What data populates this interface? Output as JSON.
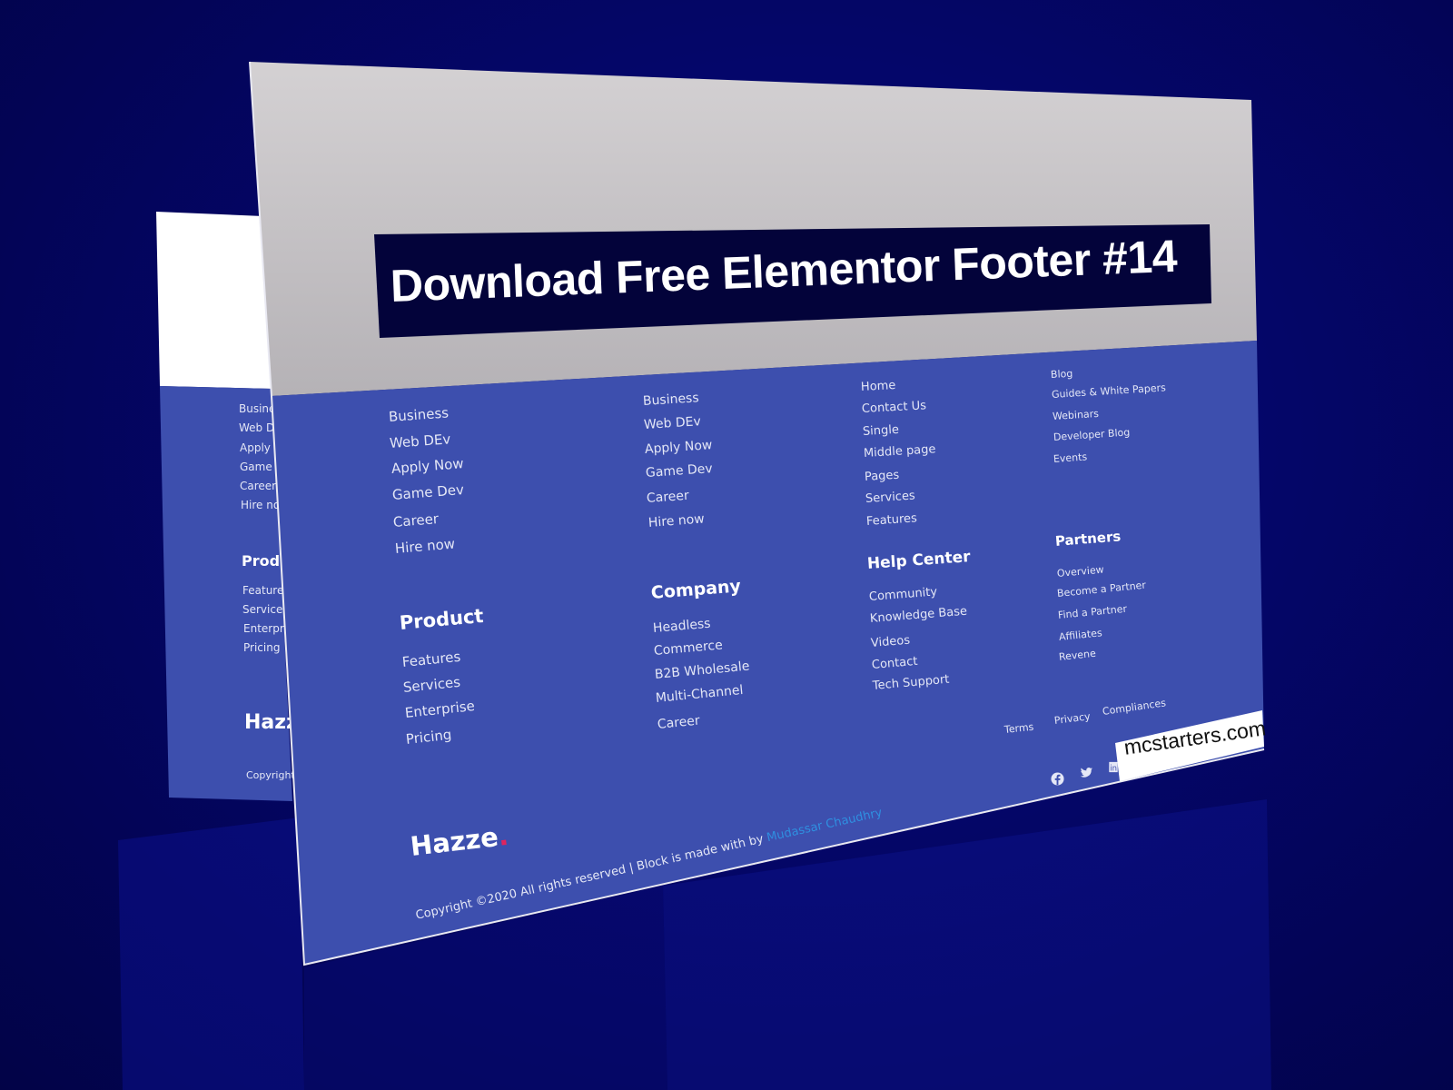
{
  "banner": {
    "title": "Download Free Elementor Footer #14"
  },
  "watermark": {
    "text": "mcstarters.com"
  },
  "colors": {
    "background": "#03055e",
    "footer_blue": "#3d4fae",
    "top_gray": "#c9c6c9",
    "title_box": "#03033a",
    "brand_dot": "#e0245e",
    "link": "#2f8fe0"
  },
  "back_card": {
    "links": [
      "Business",
      "Web DEv",
      "Apply Now",
      "Game Dev",
      "Career",
      "Hire now"
    ],
    "product_heading": "Product",
    "product_links": [
      "Features",
      "Services",
      "Enterprise",
      "Pricing"
    ],
    "brand": "Hazze",
    "copyright": "Copyright"
  },
  "footer": {
    "col1": {
      "links": [
        "Business",
        "Web DEv",
        "Apply Now",
        "Game Dev",
        "Career",
        "Hire now"
      ]
    },
    "product": {
      "heading": "Product",
      "links": [
        "Features",
        "Services",
        "Enterprise",
        "Pricing"
      ]
    },
    "col2": {
      "links": [
        "Business",
        "Web DEv",
        "Apply Now",
        "Game Dev",
        "Career",
        "Hire now"
      ]
    },
    "company": {
      "heading": "Company",
      "links": [
        "Headless",
        "Commerce",
        "B2B Wholesale",
        "Multi-Channel",
        "Career"
      ]
    },
    "col3": {
      "links": [
        "Home",
        "Contact Us",
        "Single",
        "Middle page",
        "Pages",
        "Services",
        "Features"
      ]
    },
    "help_center": {
      "heading": "Help Center",
      "links": [
        "Community",
        "Knowledge Base",
        "Videos",
        "Contact",
        "Tech Support"
      ]
    },
    "col4": {
      "links": [
        "Blog",
        "Guides & White Papers",
        "Webinars",
        "Developer Blog",
        "Events"
      ]
    },
    "partners": {
      "heading": "Partners",
      "links": [
        "Overview",
        "Become a Partner",
        "Find a Partner",
        "Affiliates",
        "Revene"
      ]
    },
    "legal": [
      "Terms",
      "Privacy",
      "Compliances"
    ],
    "social": [
      "facebook-icon",
      "twitter-icon",
      "linkedin-icon"
    ],
    "brand": "Hazze",
    "brand_dot": ".",
    "copyright": "Copyright ©2020 All rights reserved | Block is made with by",
    "author": "Mudassar Chaudhry"
  }
}
